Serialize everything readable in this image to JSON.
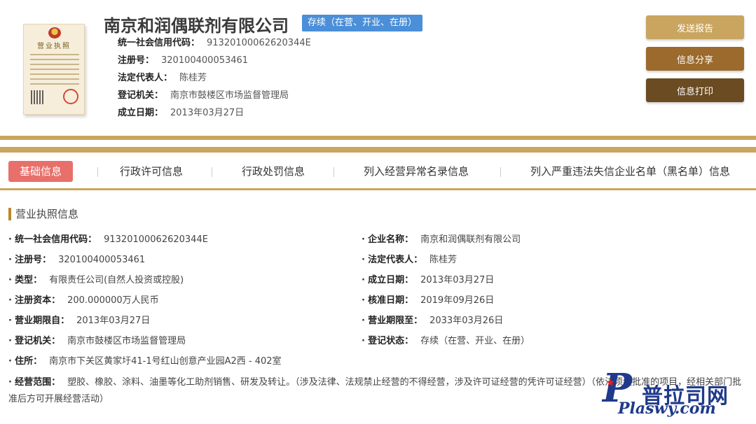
{
  "company": {
    "name": "南京和润偶联剂有限公司",
    "status_badge": "存续（在营、开业、在册）"
  },
  "summary": [
    {
      "label": "统一社会信用代码：",
      "value": "91320100062620344E"
    },
    {
      "label": "注册号：",
      "value": "320100400053461"
    },
    {
      "label": "法定代表人：",
      "value": "陈桂芳"
    },
    {
      "label": "登记机关：",
      "value": "南京市鼓楼区市场监督管理局"
    },
    {
      "label": "成立日期：",
      "value": "2013年03月27日"
    }
  ],
  "actions": {
    "report": "发送报告",
    "share": "信息分享",
    "print": "信息打印"
  },
  "tabs": [
    {
      "label": "基础信息",
      "active": true
    },
    {
      "label": "行政许可信息",
      "active": false
    },
    {
      "label": "行政处罚信息",
      "active": false
    },
    {
      "label": "列入经营异常名录信息",
      "active": false
    },
    {
      "label": "列入严重违法失信企业名单（黑名单）信息",
      "active": false
    }
  ],
  "section": {
    "title": "营业执照信息",
    "bullet": "·",
    "left": [
      {
        "label": "统一社会信用代码：",
        "value": "91320100062620344E"
      },
      {
        "label": "注册号：",
        "value": "320100400053461"
      },
      {
        "label": "类型：",
        "value": "有限责任公司(自然人投资或控股)"
      },
      {
        "label": "注册资本：",
        "value": "200.000000万人民币"
      },
      {
        "label": "营业期限自：",
        "value": "2013年03月27日"
      },
      {
        "label": "登记机关：",
        "value": "南京市鼓楼区市场监督管理局"
      },
      {
        "label": "住所：",
        "value": "南京市下关区黄家圩41-1号红山创意产业园A2西 - 402室"
      }
    ],
    "right": [
      {
        "label": "企业名称：",
        "value": "南京和润偶联剂有限公司"
      },
      {
        "label": "法定代表人：",
        "value": "陈桂芳"
      },
      {
        "label": "成立日期：",
        "value": "2013年03月27日"
      },
      {
        "label": "核准日期：",
        "value": "2019年09月26日"
      },
      {
        "label": "营业期限至：",
        "value": "2033年03月26日"
      },
      {
        "label": "登记状态：",
        "value": "存续（在营、开业、在册）"
      }
    ],
    "scope": {
      "label": "经营范围：",
      "value": "塑胶、橡胶、涂料、油墨等化工助剂销售、研发及转让。（涉及法律、法规禁止经营的不得经营，涉及许可证经营的凭许可证经营）（依法须经批准的项目，经相关部门批准后方可开展经营活动）"
    }
  },
  "license_image": {
    "title": "营业执照"
  },
  "watermark": {
    "letter": "P",
    "cn": "普拉司网",
    "en": "Plaswy.com"
  }
}
